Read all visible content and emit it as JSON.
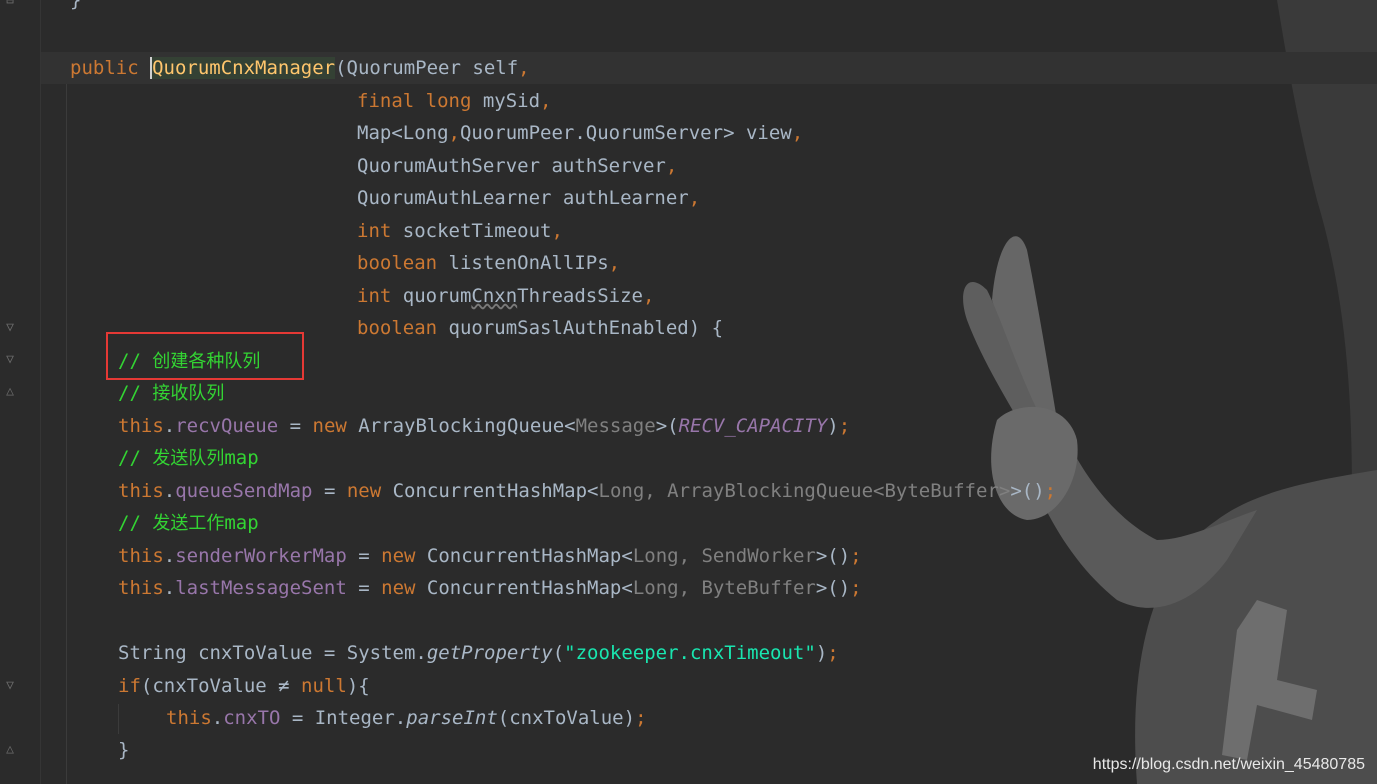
{
  "editor": {
    "language": "java",
    "lines": [
      {
        "text": "}"
      },
      {
        "text": ""
      },
      {
        "parts": [
          [
            "kw",
            "public "
          ],
          [
            "fn",
            "QuorumCnxManager"
          ],
          [
            "",
            "(QuorumPeer self"
          ],
          [
            "kw",
            ","
          ]
        ]
      },
      {
        "parts": [
          [
            "kw",
            "final long "
          ],
          [
            "",
            "mySid"
          ],
          [
            "kw",
            ","
          ]
        ]
      },
      {
        "parts": [
          [
            "",
            "Map<Long"
          ],
          [
            "kw",
            ","
          ],
          [
            "",
            "QuorumPeer.QuorumServer> view"
          ],
          [
            "kw",
            ","
          ]
        ]
      },
      {
        "parts": [
          [
            "",
            "QuorumAuthServer authServer"
          ],
          [
            "kw",
            ","
          ]
        ]
      },
      {
        "parts": [
          [
            "",
            "QuorumAuthLearner authLearner"
          ],
          [
            "kw",
            ","
          ]
        ]
      },
      {
        "parts": [
          [
            "kw",
            "int "
          ],
          [
            "",
            "socketTimeout"
          ],
          [
            "kw",
            ","
          ]
        ]
      },
      {
        "parts": [
          [
            "kw",
            "boolean "
          ],
          [
            "",
            "listenOnAllIPs"
          ],
          [
            "kw",
            ","
          ]
        ]
      },
      {
        "parts": [
          [
            "kw",
            "int "
          ],
          [
            "",
            "quorumCnxnThreadsSize"
          ],
          [
            "kw",
            ","
          ]
        ]
      },
      {
        "parts": [
          [
            "kw",
            "boolean "
          ],
          [
            "",
            "quorumSaslAuthEnabled) {"
          ]
        ]
      },
      {
        "text": "// 创建各种队列"
      },
      {
        "text": "// 接收队列"
      },
      {
        "text": "this.recvQueue = new ArrayBlockingQueue<Message>(RECV_CAPACITY);"
      },
      {
        "text": "// 发送队列map"
      },
      {
        "text": "this.queueSendMap = new ConcurrentHashMap<Long, ArrayBlockingQueue<ByteBuffer>>();"
      },
      {
        "text": "// 发送工作map"
      },
      {
        "text": "this.senderWorkerMap = new ConcurrentHashMap<Long, SendWorker>();"
      },
      {
        "text": "this.lastMessageSent = new ConcurrentHashMap<Long, ByteBuffer>();"
      },
      {
        "text": ""
      },
      {
        "text": "String cnxToValue = System.getProperty(\"zookeeper.cnxTimeout\");"
      },
      {
        "text": "if(cnxToValue ≠ null){"
      },
      {
        "text": "this.cnxTO = Integer.parseInt(cnxToValue);"
      },
      {
        "text": "}"
      }
    ]
  },
  "annotation": {
    "highlighted_comment": "// 创建各种队列",
    "box_color": "#e53935"
  },
  "watermark": "https://blog.csdn.net/weixin_45480785",
  "colors": {
    "background": "#2b2b2b",
    "keyword": "#cc7832",
    "method": "#ffc66d",
    "field": "#9876aa",
    "comment": "#33d433",
    "string": "#19e6b0",
    "text": "#a9b7c6"
  },
  "icons": [
    "fold-collapse-icon",
    "fold-expand-icon"
  ]
}
